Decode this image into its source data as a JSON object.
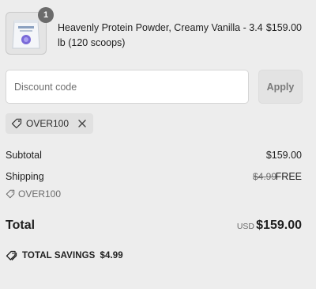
{
  "product": {
    "quantity": "1",
    "name": "Heavenly Protein Powder, Creamy Vanilla - 3.4 lb (120 scoops)",
    "price": "$159.00"
  },
  "discount": {
    "placeholder": "Discount code",
    "apply_label": "Apply",
    "applied_code": "OVER100"
  },
  "summary": {
    "subtotal_label": "Subtotal",
    "subtotal_value": "$159.00",
    "shipping_label": "Shipping",
    "shipping_original": "$4.99",
    "shipping_value": "FREE",
    "shipping_code": "OVER100",
    "total_label": "Total",
    "total_currency": "USD",
    "total_value": "$159.00",
    "savings_label": "TOTAL SAVINGS",
    "savings_value": "$4.99"
  },
  "icons": {
    "tag": "tag-icon",
    "remove": "close-icon",
    "savings": "tags-icon"
  },
  "colors": {
    "background": "#ededed",
    "badge": "#6b6b6b",
    "muted_text": "#6b6b6b"
  }
}
